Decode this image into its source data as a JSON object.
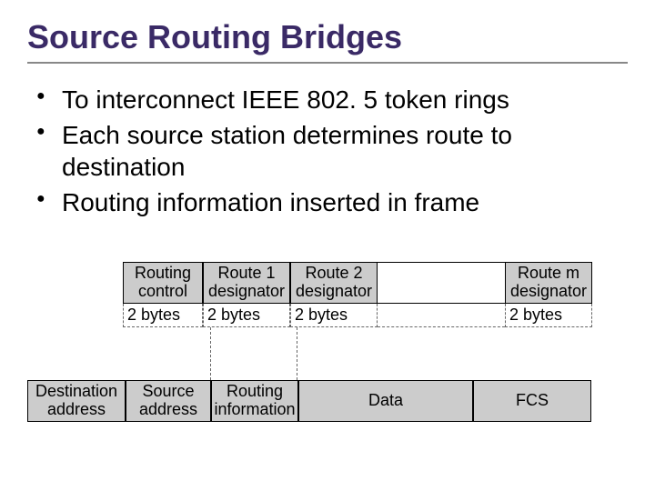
{
  "title": "Source Routing Bridges",
  "bullets": [
    "To interconnect IEEE 802. 5 token rings",
    "Each source station determines route to destination",
    "Routing information inserted in frame"
  ],
  "routing_info_row": {
    "cells": [
      {
        "text": "Routing\ncontrol"
      },
      {
        "text": "Route 1\ndesignator"
      },
      {
        "text": "Route 2\ndesignator"
      },
      {
        "text": "Route m\ndesignator"
      }
    ],
    "sizes": [
      "2 bytes",
      "2 bytes",
      "2 bytes",
      "2 bytes"
    ]
  },
  "frame_row": {
    "cells": [
      "Destination\naddress",
      "Source\naddress",
      "Routing\ninformation",
      "Data",
      "FCS"
    ]
  }
}
